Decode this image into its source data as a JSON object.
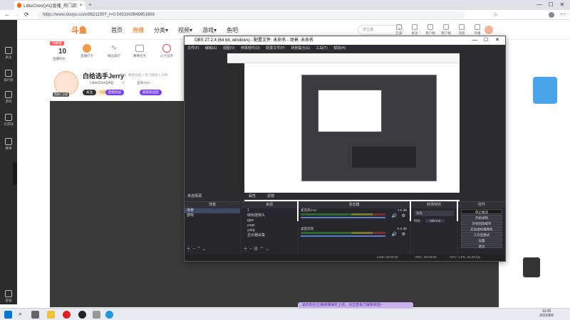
{
  "browser": {
    "tab_title": "LittleChenQAQ直播_热门游戏直",
    "url": "https://www.douyu.com/8621150?_r=0.5453169848951689",
    "window_min": "—",
    "window_max": "☐",
    "window_close": "✕"
  },
  "sidebar": {
    "items": [
      {
        "label": "关注"
      },
      {
        "label": "排行榜"
      },
      {
        "label": "游戏"
      },
      {
        "label": "云游戏"
      },
      {
        "label": "赛事"
      },
      {
        "label": "客服"
      }
    ]
  },
  "header": {
    "logo": "斗鱼",
    "nav": [
      "首页",
      "直播",
      "分类▾",
      "视频▾",
      "游戏▾",
      "鱼吧"
    ],
    "search_placeholder": "搜主播",
    "icons": [
      {
        "label": "历史"
      },
      {
        "label": "关注"
      },
      {
        "label": "客户端"
      },
      {
        "label": "客户端"
      },
      {
        "label": "消息"
      },
      {
        "label": "开播"
      }
    ]
  },
  "room": {
    "badge": "待解锁",
    "level": "10",
    "level_label": "直播时长",
    "stats": [
      {
        "label": "直播打卡"
      },
      {
        "label": "精品排行"
      },
      {
        "label": "赛事任务"
      },
      {
        "label": "火力全开"
      }
    ],
    "streamer_name": "白给选手Jerry",
    "report": "举报",
    "category": "网游竞技 > 热门游戏 > 大神",
    "owner": "LittleChenQAQ",
    "owner_level": "6",
    "owner_fans": "查询TOC",
    "follow": "关注",
    "tag1": "冷兵器",
    "tag2": "超级挑战",
    "tag3": "超级粉丝团",
    "badge_left": "鱼粉 | 立即"
  },
  "obs": {
    "title": "OBS 27.2.4 (64 bit, windows) - 配置文件: 未命名 - 场景: 未命名",
    "menu": [
      "文件(F)",
      "编辑(E)",
      "视图(V)",
      "停靠部件(D)",
      "配置文件(P)",
      "场景集合(S)",
      "工具(T)",
      "帮助(H)"
    ],
    "scene_label": "未选择源",
    "props_btn": "属性",
    "filters_btn": "滤镜",
    "docks": {
      "scenes": "场景",
      "sources": "来源",
      "mixer": "混音器",
      "transitions": "转场特效",
      "controls": "控件"
    },
    "scenes": [
      "场景",
      "游戏"
    ],
    "sources": [
      "1",
      "映射摄像头",
      "gjax",
      "yuge",
      "yukg",
      "显示器采集"
    ],
    "mixer": [
      {
        "name": "麦克风/Aux",
        "db": "0.0 dB"
      },
      {
        "name": "桌面音频",
        "db": "-6.6 dB"
      }
    ],
    "transition_value": "淡化",
    "duration_label": "时长",
    "duration_value": "300 ms",
    "controls": [
      "停止推流",
      "开始录制",
      "开始回放缓存",
      "启动虚拟摄像机",
      "工作室模式",
      "设置",
      "退出"
    ],
    "status": {
      "live": "LIVE: 00:00:00",
      "rec": "REC: 00:00:00",
      "cpu": "CPU: 1.5%, 60.00 fps"
    }
  },
  "promo": {
    "text": "钻石粉丝主播读播抽奖上线，点击查看已解锁奖励~"
  },
  "taskbar": {
    "time": "10:05",
    "date": "2022/8/8"
  },
  "colors": {
    "accent": "#ff7a00",
    "sidebar_bg": "#2b2b2b",
    "obs_bg": "#2b2b30",
    "promo_bg": "#c9b0ef"
  }
}
